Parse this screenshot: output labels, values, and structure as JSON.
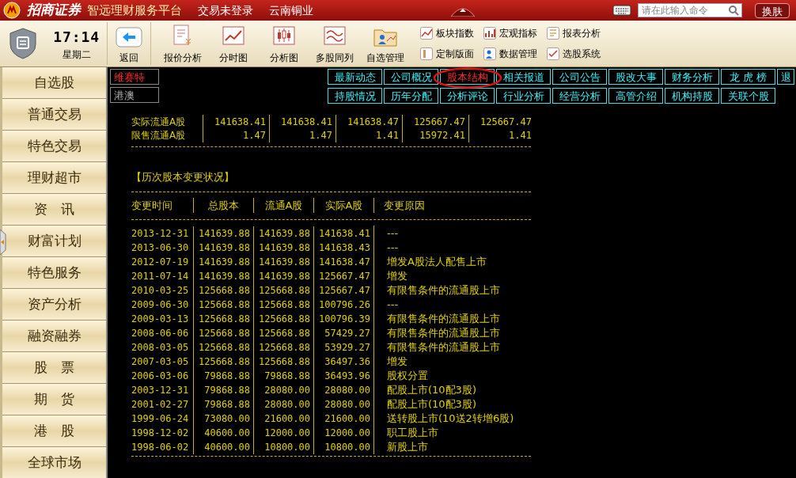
{
  "top_bar": {
    "brand": "招商证券",
    "platform": "智远理财服务平台",
    "login_status": "交易未登录",
    "stock_name": "云南铜业",
    "command_placeholder": "请在此输入命令",
    "skin_button": "换肤"
  },
  "clock": {
    "time": "17:14",
    "weekday": "星期二"
  },
  "toolbar": {
    "buttons": [
      {
        "label": "返回",
        "kind": "back"
      },
      {
        "label": "报价分析",
        "kind": "quote"
      },
      {
        "label": "分时图",
        "kind": "intraday"
      },
      {
        "label": "分析图",
        "kind": "candle"
      },
      {
        "label": "多股同列",
        "kind": "multi"
      },
      {
        "label": "自选管理",
        "kind": "manage"
      }
    ],
    "small_buttons": [
      {
        "label": "板块指数",
        "kind": "sector"
      },
      {
        "label": "宏观指标",
        "kind": "macro"
      },
      {
        "label": "报表分析",
        "kind": "report"
      },
      {
        "label": "定制版面",
        "kind": "layout"
      },
      {
        "label": "数据管理",
        "kind": "data"
      },
      {
        "label": "选股系统",
        "kind": "picker"
      }
    ]
  },
  "sidebar": {
    "items": [
      "自选股",
      "普通交易",
      "特色交易",
      "理财超市",
      "资　讯",
      "财富计划",
      "特色服务",
      "资产分析",
      "融资融券",
      "股　票",
      "期　货",
      "港　股",
      "全球市场"
    ]
  },
  "sources": [
    {
      "label": "维赛特",
      "selected": true
    },
    {
      "label": "港澳",
      "selected": false
    }
  ],
  "tabs": [
    {
      "label": "最新动态",
      "selected": false
    },
    {
      "label": "公司概况",
      "selected": false
    },
    {
      "label": "股本结构",
      "selected": true
    },
    {
      "label": "相关报道",
      "selected": false
    },
    {
      "label": "公司公告",
      "selected": false
    },
    {
      "label": "股改大事",
      "selected": false
    },
    {
      "label": "财务分析",
      "selected": false
    },
    {
      "label": "龙 虎 榜",
      "selected": false
    },
    {
      "label": "退",
      "selected": false
    },
    {
      "label": "持股情况",
      "selected": false
    },
    {
      "label": "历年分配",
      "selected": false
    },
    {
      "label": "分析评论",
      "selected": false
    },
    {
      "label": "行业分析",
      "selected": false
    },
    {
      "label": "经营分析",
      "selected": false
    },
    {
      "label": "高管介绍",
      "selected": false
    },
    {
      "label": "机构持股",
      "selected": false
    },
    {
      "label": "关联个股",
      "selected": false
    }
  ],
  "summary_rows": [
    {
      "label": "实际流通A股",
      "values": [
        "141638.41",
        "141638.41",
        "141638.47",
        "125667.47",
        "125667.47"
      ]
    },
    {
      "label": "限售流通A股",
      "values": [
        "1.47",
        "1.47",
        "1.41",
        "15972.41",
        "1.41"
      ]
    }
  ],
  "history": {
    "title": "【历次股本变更状况】",
    "columns": [
      "变更时间",
      "总股本",
      "流通A股",
      "实际A股",
      "变更原因"
    ],
    "rows": [
      [
        "2013-12-31",
        "141639.88",
        "141639.88",
        "141638.41",
        "---"
      ],
      [
        "2013-06-30",
        "141639.88",
        "141639.88",
        "141638.43",
        "---"
      ],
      [
        "2012-07-19",
        "141639.88",
        "141639.88",
        "141638.47",
        "增发A股法人配售上市"
      ],
      [
        "2011-07-14",
        "141639.88",
        "141639.88",
        "125667.47",
        "增发"
      ],
      [
        "2010-03-25",
        "125668.88",
        "125668.88",
        "125667.47",
        "有限售条件的流通股上市"
      ],
      [
        "2009-06-30",
        "125668.88",
        "125668.88",
        "100796.26",
        "---"
      ],
      [
        "2009-03-13",
        "125668.88",
        "125668.88",
        "100796.39",
        "有限售条件的流通股上市"
      ],
      [
        "2008-06-06",
        "125668.88",
        "125668.88",
        "57429.27",
        "有限售条件的流通股上市"
      ],
      [
        "2008-03-05",
        "125668.88",
        "125668.88",
        "53929.27",
        "有限售条件的流通股上市"
      ],
      [
        "2007-03-05",
        "125668.88",
        "125668.88",
        "36497.36",
        "增发"
      ],
      [
        "2006-03-06",
        "79868.88",
        "79868.88",
        "36493.96",
        "股权分置"
      ],
      [
        "2003-12-31",
        "79868.88",
        "28080.00",
        "28080.00",
        "配股上市(10配3股)"
      ],
      [
        "2001-02-27",
        "79868.88",
        "28080.00",
        "28080.00",
        "配股上市(10配3股)"
      ],
      [
        "1999-06-24",
        "73080.00",
        "21600.00",
        "21600.00",
        "送转股上市(10送2转增6股)"
      ],
      [
        "1998-12-02",
        "40600.00",
        "12000.00",
        "12000.00",
        "职工股上市"
      ],
      [
        "1998-06-02",
        "40600.00",
        "10800.00",
        "10800.00",
        "新股上市"
      ]
    ]
  }
}
